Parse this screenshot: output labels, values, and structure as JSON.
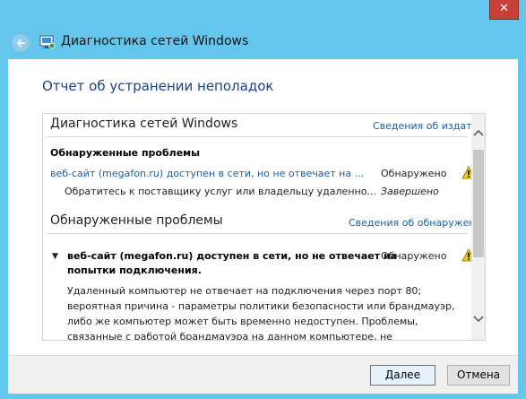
{
  "window": {
    "title": "Диагностика сетей Windows",
    "close_label": "✕"
  },
  "content": {
    "heading": "Отчет об устранении неполадок"
  },
  "report": {
    "section1": {
      "title": "Диагностика сетей Windows",
      "link": "Сведения об издателе",
      "problems_label": "Обнаруженные проблемы",
      "problem_link": "веб-сайт (megafon.ru) доступен в сети, но не отвечает на ...",
      "problem_status": "Обнаружено",
      "solution_text": "Обратитесь к поставщику услуг или владельцу удаленно...",
      "solution_status": "Завершено"
    },
    "section2": {
      "title": "Обнаруженные проблемы",
      "link": "Сведения об обнаружении",
      "issue_line1": "веб-сайт (megafon.ru) доступен в сети, но не отвечает на",
      "issue_line2": "попытки подключения.",
      "issue_status": "Обнаружено",
      "paragraph": [
        "Удаленный компьютер не отвечает на подключения через порт 80;",
        "вероятная причина - параметры политики безопасности или брандмауэр,",
        "либо же компьютер может быть временно недоступен. Проблемы,",
        "связанные с работой брандмауэра на данном компьютере, не"
      ]
    }
  },
  "footer": {
    "next_label": "Далее",
    "cancel_label": "Отмена"
  },
  "colors": {
    "frame": "#64c6ec",
    "heading": "#1e3e8c",
    "link": "#1a5fa8",
    "warning": "#f2c811",
    "close": "#c7403a"
  }
}
